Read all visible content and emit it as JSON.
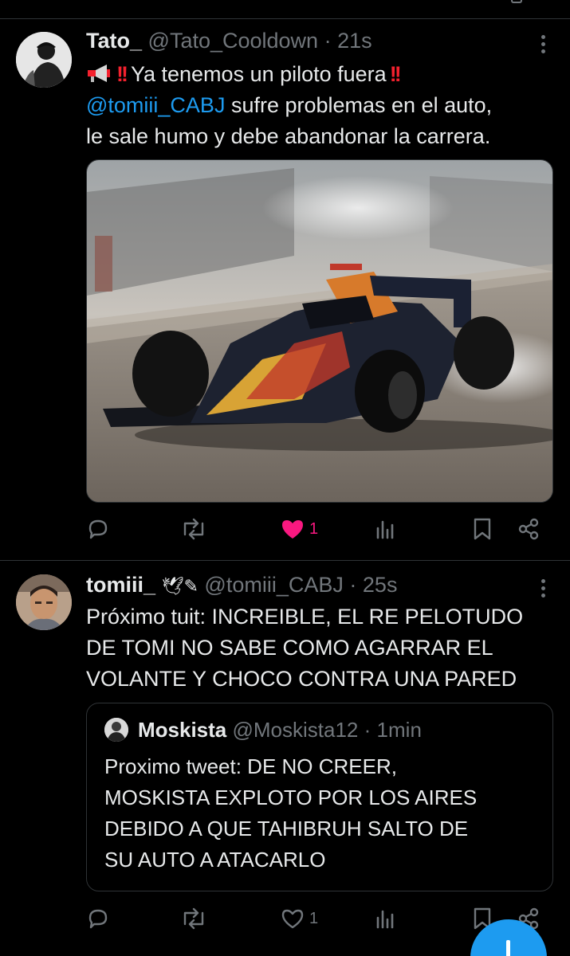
{
  "tweets": [
    {
      "author_name": "Tato_",
      "handle": "@Tato_Cooldown",
      "separator": "·",
      "time": "21s",
      "icons": [
        "megaphone-icon",
        "double-exclamation-icon"
      ],
      "text_line1": "Ya tenemos un piloto fuera",
      "mention": "@tomiii_CABJ",
      "text_rest_a": " sufre problemas en el auto,",
      "text_rest_b": "le sale humo y debe abandonar la carrera.",
      "media_icon": "f1-car-photo",
      "actions": {
        "reply_count": "",
        "retweet_count": "",
        "like_count": "1",
        "liked": true,
        "views_count": ""
      }
    },
    {
      "author_name": "tomiii_",
      "name_icons": [
        "wings-icon",
        "feather-icon"
      ],
      "handle": "@tomiii_CABJ",
      "separator": "·",
      "time": "25s",
      "text_lines": [
        "Próximo tuit: INCREIBLE, EL RE PELOTUDO",
        "DE TOMI NO SABE COMO AGARRAR EL",
        "VOLANTE Y CHOCO CONTRA UNA PARED"
      ],
      "quote": {
        "author_name": "Moskista",
        "handle": "@Moskista12",
        "separator": "·",
        "time": "1min",
        "text_lines": [
          "Proximo tweet: DE NO CREER,",
          "MOSKISTA EXPLOTO POR LOS AIRES",
          "DEBIDO A QUE TAHIBRUH SALTO DE",
          "SU AUTO A ATACARLO"
        ]
      },
      "actions": {
        "reply_count": "",
        "retweet_count": "",
        "like_count": "1",
        "liked": false,
        "views_count": ""
      }
    }
  ],
  "colors": {
    "background": "#000000",
    "text": "#e7e9ea",
    "muted": "#71767b",
    "link": "#1d9bf0",
    "like": "#f91880",
    "divider": "#2f3336",
    "alert": "#f4212e"
  }
}
